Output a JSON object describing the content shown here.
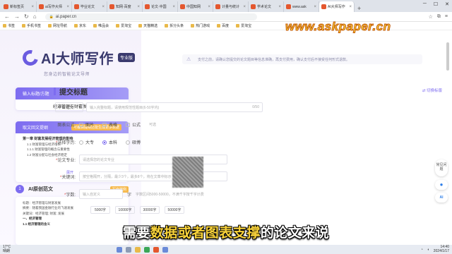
{
  "browser": {
    "tabs": [
      {
        "label": "新标签页"
      },
      {
        "label": "ai写作大师"
      },
      {
        "label": "毕业论文"
      },
      {
        "label": "知网·百度"
      },
      {
        "label": "论文·中国"
      },
      {
        "label": "中国知网"
      },
      {
        "label": "计量与统计"
      },
      {
        "label": "学术论文"
      },
      {
        "label": "www.ask"
      },
      {
        "label": "AI大师写作",
        "active": true
      }
    ],
    "new_tab": "+",
    "url": "ai.paper.cn",
    "bookmarks": [
      "书签",
      "手机书签",
      "网址导航",
      "京东",
      "唯品会",
      "爱淘宝",
      "天猫精选",
      "拆分头条",
      "热门游戏",
      "百度",
      "爱淘宝"
    ]
  },
  "watermark": "www.askpaper.cn",
  "left_panel": {
    "logo_text": "AI大师写作",
    "pro_badge": "专业版",
    "slogan": "您身边的智能论文导师",
    "step1": {
      "head": "输入标题/方题",
      "value": "经济管理与财富发展"
    },
    "step2": {
      "head": "取文回文提纲",
      "tag": "可编辑提纲还能生成更多数据",
      "outline": [
        {
          "text": "第一章 财富发展经济管理的影响",
          "bold": true
        },
        {
          "text": "1.1 财富管理与经济增长"
        },
        {
          "text": "1.1.1 财富管理的概念与重要性"
        },
        {
          "text": "1.2 财富分配与社会经济稳定"
        }
      ],
      "expand": "展开"
    },
    "step3": {
      "num": "1",
      "label": "AI原创范文",
      "tag": "写作样例",
      "lines": [
        {
          "text": "标题：经济管理与财富发展"
        },
        {
          "text": "摘要：随着我国金融行业的飞速发展"
        },
        {
          "text": "关键词：经济管理; 财富; 发展"
        },
        {
          "text": "一、经济管理",
          "bold": true
        },
        {
          "text": "1.1 经济管理的含义",
          "bold": true
        }
      ]
    }
  },
  "main": {
    "notice": "支付之前，请确认您提交的论文题目等信息准确，再支付费用，确认支付后不接受任何形式退款。",
    "section_title": "提交标题",
    "switch_link": "切换标版",
    "form": {
      "degree_label": "毕业论文",
      "title_placeholder": "输入完整标题，请使用规范性题目(6-50字内)",
      "title_counter": "0/50",
      "charts_label": "图表公式:",
      "charts_options": [
        "图片",
        "表格",
        "公式"
      ],
      "charts_hint": "可选",
      "level_label": "选择学历:",
      "level_options": [
        "大专",
        "本科",
        "硕博"
      ],
      "level_selected": "本科",
      "major_label": "论文专业:",
      "major_placeholder": "请选择您的论文专业",
      "keywords_label": "关键词:",
      "keywords_placeholder": "按空格隔开，分隔，最少3个，最多8个，将在文章中标示",
      "wordcount_label": "字数:",
      "wordcount_placeholder": "输入自定义",
      "wordcount_unit": "字",
      "wordcount_hint": "字数区间5000-50000，不满千字按千字计费",
      "wordcount_options": [
        "5000字",
        "10000字",
        "30000字",
        "50000字"
      ]
    }
  },
  "floating": {
    "help": "常见问题",
    "ai": "AI"
  },
  "subtitle": {
    "before": "需要",
    "highlight": "数据或者图表支撑",
    "after": "的论文来说"
  },
  "taskbar": {
    "temp": "17°C",
    "weather": "晴朗",
    "time": "14:40",
    "date": "2024/1/17"
  }
}
